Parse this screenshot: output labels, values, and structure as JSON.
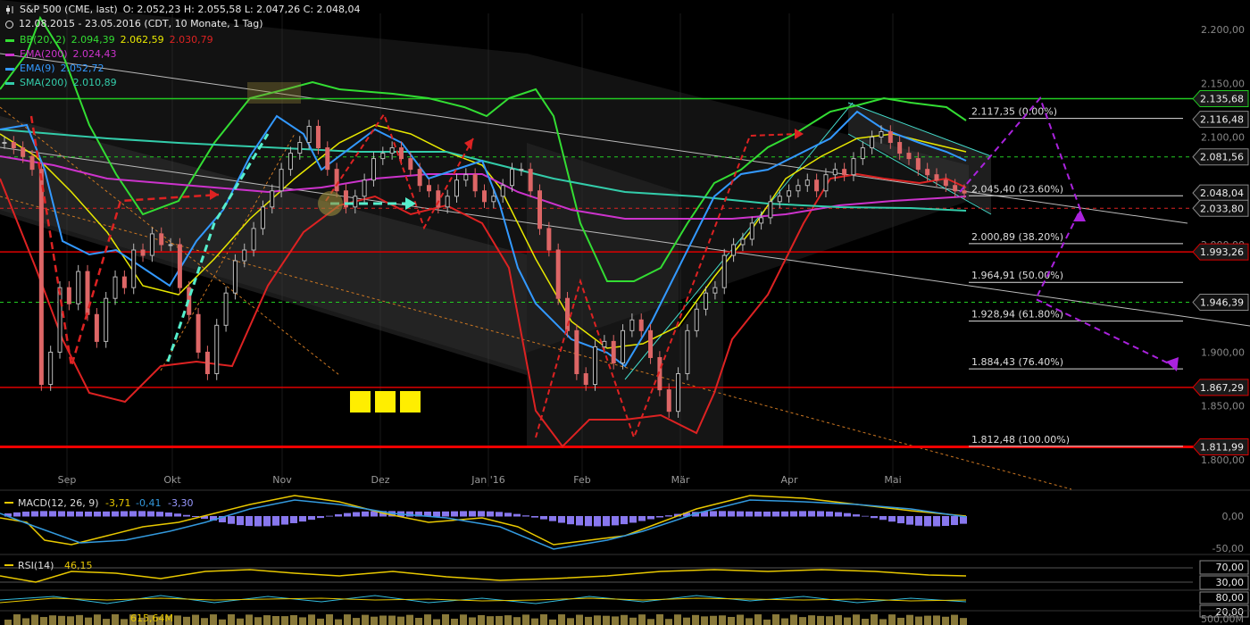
{
  "header": {
    "title": "S&P 500 (CME, last)",
    "ohlc": "O: 2.052,23  H: 2.055,58  L: 2.047,26  C: 2.048,04",
    "range": "12.08.2015 - 23.05.2016 (CDT, 10 Monate, 1 Tag)",
    "indicators": [
      {
        "label": "BB(20, 2)",
        "values": [
          {
            "text": "2.094,39",
            "color": "#33dd33"
          },
          {
            "text": "2.062,59",
            "color": "#e8e800"
          },
          {
            "text": "2.030,79",
            "color": "#dd2222"
          }
        ],
        "color": "#33dd33"
      },
      {
        "label": "EMA(200)",
        "values": [
          {
            "text": "2.024,43",
            "color": "#cc33cc"
          }
        ],
        "color": "#cc33cc"
      },
      {
        "label": "EMA(9)",
        "values": [
          {
            "text": "2.052,72",
            "color": "#3399ff"
          }
        ],
        "color": "#3399ff"
      },
      {
        "label": "SMA(200)",
        "values": [
          {
            "text": "2.010,89",
            "color": "#33ccaa"
          }
        ],
        "color": "#33ccaa"
      }
    ]
  },
  "colors": {
    "bb_upper": "#33dd33",
    "bb_mid": "#e8e800",
    "bb_lower": "#dd2222",
    "ema200": "#cc33cc",
    "ema9": "#3399ff",
    "sma200": "#33ccaa",
    "candle_up": "#bbbbbb",
    "candle_down": "#dd6666",
    "level_red": "#dd0000",
    "level_green": "#22cc22",
    "fib": "#dddddd",
    "projection": "#aa22dd",
    "teal": "#44ddcc"
  },
  "chart_data": {
    "type": "candlestick",
    "symbol": "S&P 500 (CME, last)",
    "ylim": [
      1775,
      2215
    ],
    "y_ticks": [
      "2.200,00",
      "2.150,00",
      "2.100,00",
      "2.050,00",
      "2.000,00",
      "1.950,00",
      "1.900,00",
      "1.850,00",
      "1.800,00"
    ],
    "x_ticks": [
      "Sep",
      "Okt",
      "Nov",
      "Dez",
      "Jan '16",
      "Feb",
      "Mär",
      "Apr",
      "Mai"
    ],
    "price_labels": [
      {
        "text": "2.135,68",
        "value": 2135.68,
        "kind": "green"
      },
      {
        "text": "2.116,48",
        "value": 2116.48,
        "kind": "plain"
      },
      {
        "text": "2.081,56",
        "value": 2081.56,
        "kind": "plain"
      },
      {
        "text": "2.048,04",
        "value": 2048.04,
        "kind": "plain"
      },
      {
        "text": "2.033,80",
        "value": 2033.8,
        "kind": "plain"
      },
      {
        "text": "1.993,26",
        "value": 1993.26,
        "kind": "red"
      },
      {
        "text": "1.946,39",
        "value": 1946.39,
        "kind": "plain"
      },
      {
        "text": "1.867,29",
        "value": 1867.29,
        "kind": "red"
      },
      {
        "text": "1.811,99",
        "value": 1811.99,
        "kind": "red"
      }
    ],
    "fibonacci": [
      {
        "text": "2.117,35 (0.00%)",
        "value": 2117.35
      },
      {
        "text": "2.045,40 (23.60%)",
        "value": 2045.4
      },
      {
        "text": "2.000,89 (38.20%)",
        "value": 2000.89
      },
      {
        "text": "1.964,91 (50.00%)",
        "value": 1964.91
      },
      {
        "text": "1.928,94 (61.80%)",
        "value": 1928.94
      },
      {
        "text": "1.884,43 (76.40%)",
        "value": 1884.43
      },
      {
        "text": "1.812,48 (100.00%)",
        "value": 1812.48
      }
    ],
    "levels": [
      {
        "value": 2135.68,
        "color": "#22cc22",
        "style": "solid"
      },
      {
        "value": 2081.56,
        "color": "#22cc22",
        "style": "dashed"
      },
      {
        "value": 2033.8,
        "color": "#dd2222",
        "style": "dashed"
      },
      {
        "value": 1993.26,
        "color": "#dd0000",
        "style": "solid"
      },
      {
        "value": 1946.39,
        "color": "#22cc22",
        "style": "dashed"
      },
      {
        "value": 1867.29,
        "color": "#dd0000",
        "style": "solid"
      },
      {
        "value": 1811.99,
        "color": "#ee0000",
        "style": "thick"
      }
    ],
    "ohlc_close_path": [
      2095,
      2090,
      2082,
      2070,
      1870,
      1900,
      1960,
      1945,
      1975,
      1935,
      1910,
      1950,
      1970,
      1960,
      1995,
      1990,
      2010,
      2000,
      2000,
      1960,
      1935,
      1900,
      1880,
      1925,
      1955,
      1985,
      1995,
      2015,
      2035,
      2050,
      2070,
      2085,
      2095,
      2110,
      2090,
      2070,
      2050,
      2035,
      2045,
      2060,
      2080,
      2085,
      2090,
      2080,
      2070,
      2055,
      2050,
      2035,
      2045,
      2060,
      2065,
      2050,
      2040,
      2045,
      2055,
      2070,
      2070,
      2050,
      2015,
      1995,
      1950,
      1920,
      1880,
      1870,
      1905,
      1910,
      1890,
      1920,
      1930,
      1920,
      1895,
      1865,
      1845,
      1880,
      1920,
      1940,
      1955,
      1960,
      1990,
      2000,
      2005,
      2020,
      2025,
      2040,
      2045,
      2050,
      2055,
      2060,
      2050,
      2065,
      2070,
      2065,
      2080,
      2090,
      2100,
      2105,
      2095,
      2085,
      2080,
      2070,
      2065,
      2060,
      2055,
      2050,
      2048
    ]
  },
  "macd": {
    "label": "MACD(12, 26, 9)",
    "v1": "-3,71",
    "v2": "-0,41",
    "v3": "-3,30",
    "zero": "0,00",
    "low": "-50,00",
    "c1": "#e8c800",
    "c2": "#3399dd",
    "c3": "#9999ff"
  },
  "rsi": {
    "label": "RSI(14)",
    "value": "46,15",
    "upper": "70,00",
    "lower": "30,00",
    "color": "#e8c800"
  },
  "stoch": {
    "upper": "80,00",
    "lower": "20,00"
  },
  "volume": {
    "text": "615,64M",
    "right": "500,00M"
  }
}
